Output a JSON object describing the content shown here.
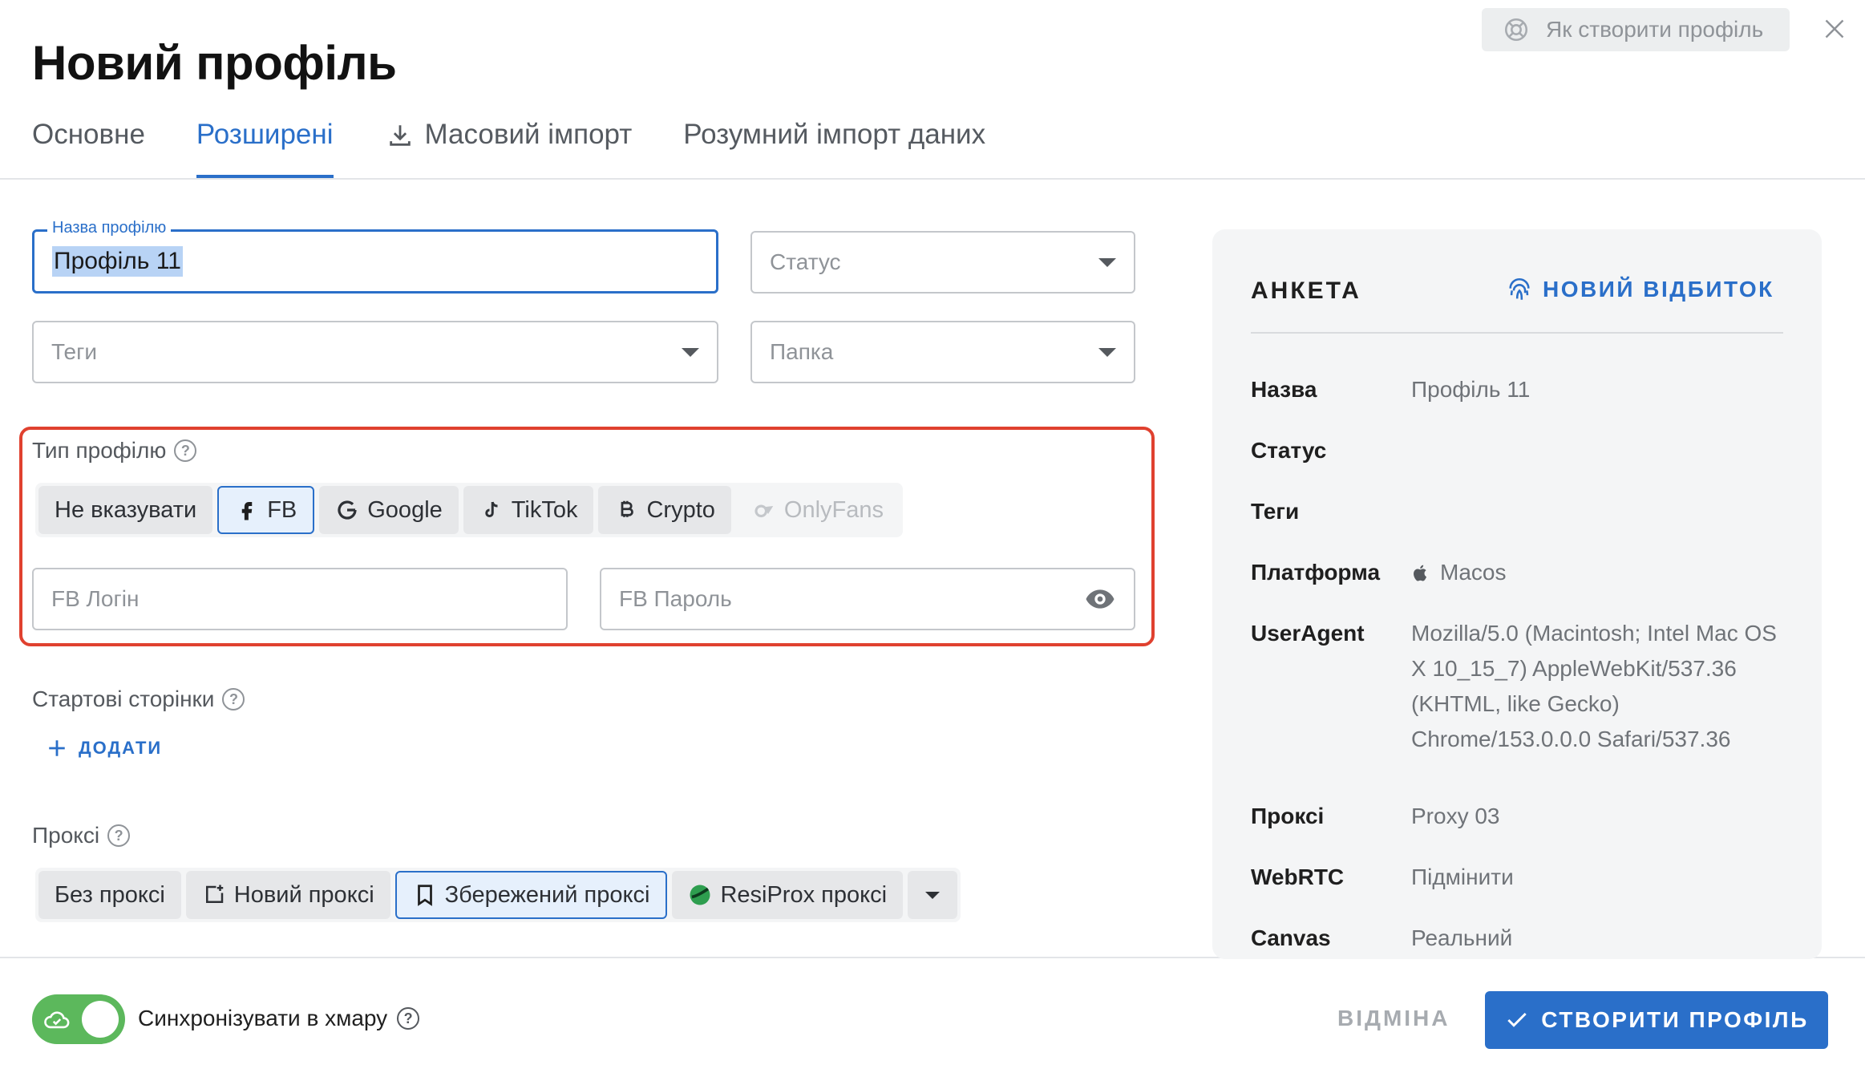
{
  "header": {
    "title": "Новий профіль",
    "help_label": "Як створити профіль"
  },
  "tabs": [
    {
      "label": "Основне",
      "active": false
    },
    {
      "label": "Розширені",
      "active": true
    },
    {
      "label": "Масовий імпорт",
      "active": false,
      "icon": "download-icon"
    },
    {
      "label": "Розумний імпорт даних",
      "active": false
    }
  ],
  "form": {
    "profile_name": {
      "label": "Назва профілю",
      "value": "Профіль 11"
    },
    "status": {
      "placeholder": "Статус"
    },
    "tags": {
      "placeholder": "Теги"
    },
    "folder": {
      "placeholder": "Папка"
    }
  },
  "profile_type": {
    "label": "Тип профілю",
    "options": [
      {
        "label": "Не вказувати",
        "icon": ""
      },
      {
        "label": "FB",
        "icon": "facebook-icon",
        "selected": true
      },
      {
        "label": "Google",
        "icon": "google-icon"
      },
      {
        "label": "TikTok",
        "icon": "tiktok-icon"
      },
      {
        "label": "Crypto",
        "icon": "bitcoin-icon"
      },
      {
        "label": "OnlyFans",
        "icon": "onlyfans-icon",
        "disabled": true
      }
    ],
    "login_placeholder": "FB Логін",
    "password_placeholder": "FB Пароль"
  },
  "start_pages": {
    "label": "Стартові сторінки",
    "add_label": "ДОДАТИ"
  },
  "proxy": {
    "label": "Проксі",
    "options": [
      {
        "label": "Без проксі"
      },
      {
        "label": "Новий проксі",
        "icon": "new-proxy-icon"
      },
      {
        "label": "Збережений проксі",
        "icon": "bookmark-icon",
        "selected": true
      },
      {
        "label": "ResiProx проксі",
        "icon": "resiprox-icon"
      }
    ]
  },
  "panel": {
    "title": "АНКЕТА",
    "action": "НОВИЙ ВІДБИТОК",
    "rows": [
      {
        "key": "Назва",
        "value": "Профіль 11"
      },
      {
        "key": "Статус",
        "value": ""
      },
      {
        "key": "Теги",
        "value": ""
      },
      {
        "key": "Платформа",
        "value": "Macos"
      },
      {
        "key": "UserAgent",
        "value": "Mozilla/5.0 (Macintosh; Intel Mac OS X 10_15_7) AppleWebKit/537.36 (KHTML, like Gecko) Chrome/153.0.0.0 Safari/537.36"
      },
      {
        "key": "Проксі",
        "value": "Proxy 03"
      },
      {
        "key": "WebRTC",
        "value": "Підмінити"
      },
      {
        "key": "Canvas",
        "value": "Реальний"
      }
    ]
  },
  "footer": {
    "sync_label": "Синхронізувати в хмару",
    "cancel_label": "ВІДМІНА",
    "create_label": "СТВОРИТИ ПРОФІЛЬ"
  },
  "colors": {
    "accent": "#2a6fc9",
    "highlight": "#e0412f",
    "toggle_on": "#5cb85c"
  }
}
